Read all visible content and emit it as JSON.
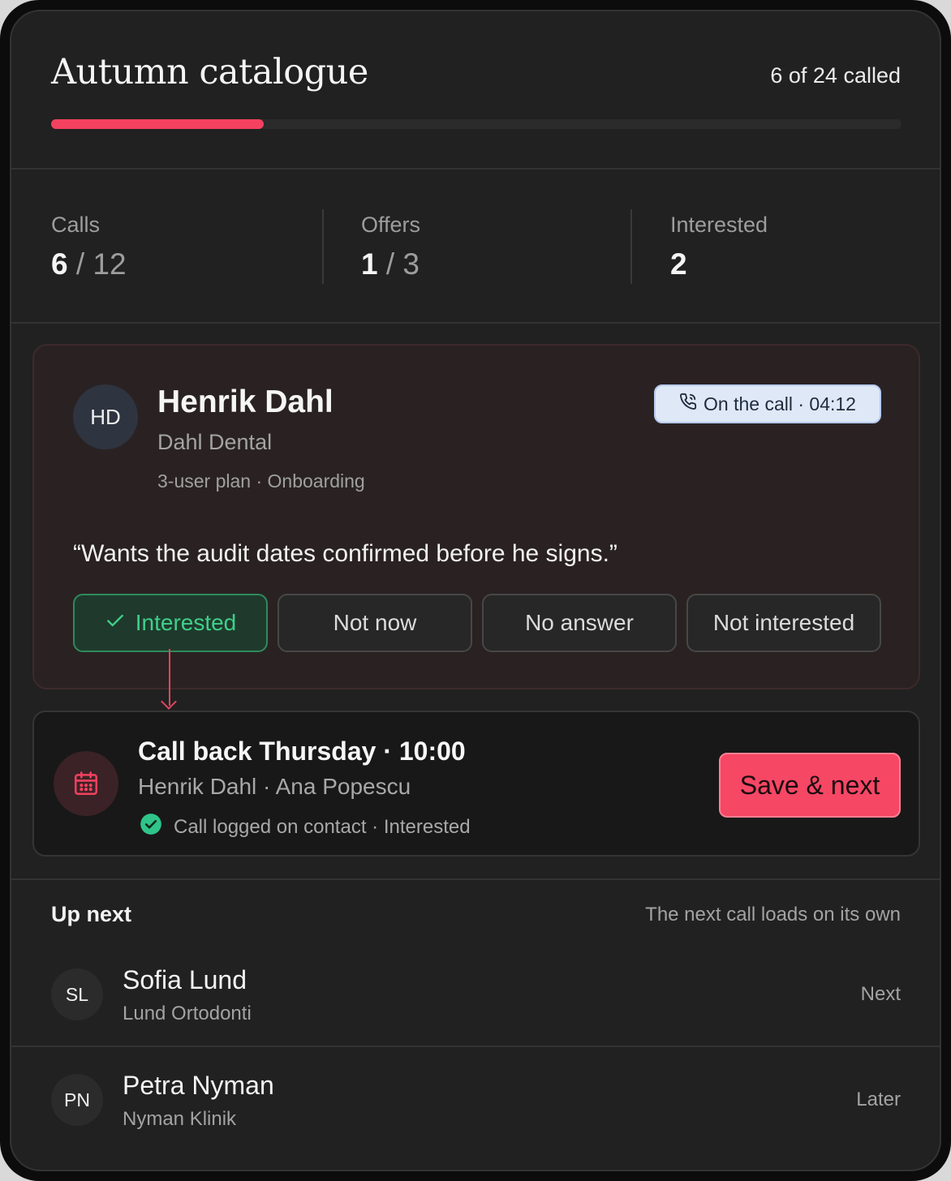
{
  "header": {
    "title": "Autumn catalogue",
    "progress_text": "6 of 24 called",
    "progress_fraction": 0.25,
    "accent_color": "#f3415f"
  },
  "stats": [
    {
      "label": "Calls",
      "value": "6",
      "total": "/ 12"
    },
    {
      "label": "Offers",
      "value": "1",
      "total": "/ 3"
    },
    {
      "label": "Interested",
      "value": "2",
      "total": ""
    }
  ],
  "current_call": {
    "initials": "HD",
    "name": "Henrik Dahl",
    "company": "Dahl Dental",
    "plan": "3-user plan · Onboarding",
    "badge": "On the call · 04:12",
    "badge_icon": "phone-icon",
    "quote": "“Wants the audit dates confirmed before he signs.”",
    "outcomes": [
      {
        "label": "Interested",
        "selected": true
      },
      {
        "label": "Not now",
        "selected": false
      },
      {
        "label": "No answer",
        "selected": false
      },
      {
        "label": "Not interested",
        "selected": false
      }
    ]
  },
  "schedule": {
    "icon": "calendar-icon",
    "title": "Call back Thursday · 10:00",
    "participants": "Henrik Dahl · Ana Popescu",
    "status": "Call logged on contact · Interested",
    "status_icon": "check-circle-icon",
    "save_label": "Save & next"
  },
  "up_next": {
    "label": "Up next",
    "note": "The next call loads on its own",
    "items": [
      {
        "initials": "SL",
        "name": "Sofia Lund",
        "company": "Lund Ortodonti",
        "status": "Next"
      },
      {
        "initials": "PN",
        "name": "Petra Nyman",
        "company": "Nyman Klinik",
        "status": "Later"
      }
    ]
  }
}
